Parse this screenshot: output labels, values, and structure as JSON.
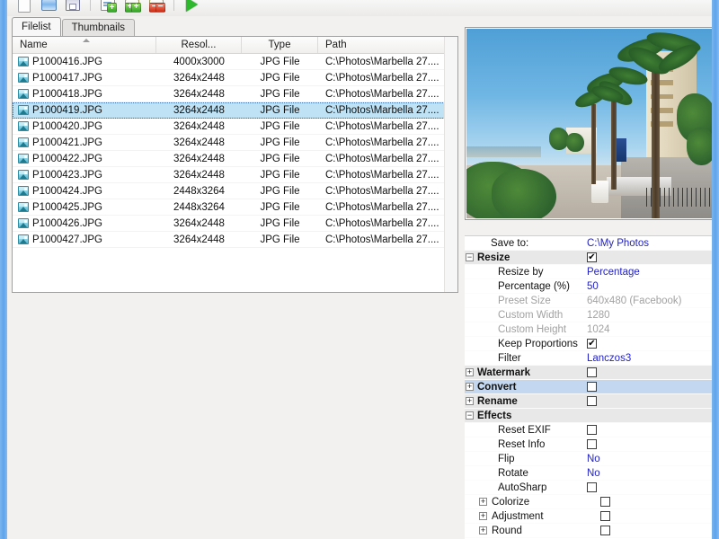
{
  "window": {
    "accent_color": "#6aa9e9"
  },
  "toolbar": {
    "buttons": [
      {
        "name": "new-document",
        "label": "New"
      },
      {
        "name": "open-folder",
        "label": "Open"
      },
      {
        "name": "save",
        "label": "Save"
      },
      {
        "name": "add-files",
        "label": "Add files"
      },
      {
        "name": "add-folder",
        "label": "Add folder"
      },
      {
        "name": "remove-files",
        "label": "Remove files"
      },
      {
        "name": "run",
        "label": "Start"
      }
    ]
  },
  "tabs": [
    {
      "label": "Filelist",
      "active": true
    },
    {
      "label": "Thumbnails",
      "active": false
    }
  ],
  "filelist": {
    "columns": [
      "Name",
      "Resol...",
      "Type",
      "Path"
    ],
    "sort_column": "Name",
    "sort_direction": "asc",
    "rows": [
      {
        "name": "P1000416.JPG",
        "resolution": "4000x3000",
        "type": "JPG File",
        "path": "C:\\Photos\\Marbella 27....",
        "selected": false
      },
      {
        "name": "P1000417.JPG",
        "resolution": "3264x2448",
        "type": "JPG File",
        "path": "C:\\Photos\\Marbella 27....",
        "selected": false
      },
      {
        "name": "P1000418.JPG",
        "resolution": "3264x2448",
        "type": "JPG File",
        "path": "C:\\Photos\\Marbella 27....",
        "selected": false
      },
      {
        "name": "P1000419.JPG",
        "resolution": "3264x2448",
        "type": "JPG File",
        "path": "C:\\Photos\\Marbella 27....",
        "selected": true
      },
      {
        "name": "P1000420.JPG",
        "resolution": "3264x2448",
        "type": "JPG File",
        "path": "C:\\Photos\\Marbella 27....",
        "selected": false
      },
      {
        "name": "P1000421.JPG",
        "resolution": "3264x2448",
        "type": "JPG File",
        "path": "C:\\Photos\\Marbella 27....",
        "selected": false
      },
      {
        "name": "P1000422.JPG",
        "resolution": "3264x2448",
        "type": "JPG File",
        "path": "C:\\Photos\\Marbella 27....",
        "selected": false
      },
      {
        "name": "P1000423.JPG",
        "resolution": "3264x2448",
        "type": "JPG File",
        "path": "C:\\Photos\\Marbella 27....",
        "selected": false
      },
      {
        "name": "P1000424.JPG",
        "resolution": "2448x3264",
        "type": "JPG File",
        "path": "C:\\Photos\\Marbella 27....",
        "selected": false
      },
      {
        "name": "P1000425.JPG",
        "resolution": "2448x3264",
        "type": "JPG File",
        "path": "C:\\Photos\\Marbella 27....",
        "selected": false
      },
      {
        "name": "P1000426.JPG",
        "resolution": "3264x2448",
        "type": "JPG File",
        "path": "C:\\Photos\\Marbella 27....",
        "selected": false
      },
      {
        "name": "P1000427.JPG",
        "resolution": "3264x2448",
        "type": "JPG File",
        "path": "C:\\Photos\\Marbella 27....",
        "selected": false
      }
    ]
  },
  "preview": {
    "name": "image-preview"
  },
  "properties": {
    "rows": [
      {
        "label": "Save to:",
        "value": "C:\\My Photos",
        "kind": "value",
        "style": "saveto"
      },
      {
        "label": "Resize",
        "kind": "check",
        "checked": true,
        "style": "group",
        "expander": "minus"
      },
      {
        "label": "Resize by",
        "value": "Percentage",
        "kind": "value",
        "style": "child"
      },
      {
        "label": "Percentage (%)",
        "value": "50",
        "kind": "value",
        "style": "child"
      },
      {
        "label": "Preset Size",
        "value": "640x480 (Facebook)",
        "kind": "value",
        "style": "child-dim"
      },
      {
        "label": "Custom Width",
        "value": "1280",
        "kind": "value",
        "style": "child-dim"
      },
      {
        "label": "Custom Height",
        "value": "1024",
        "kind": "value",
        "style": "child-dim"
      },
      {
        "label": "Keep Proportions",
        "kind": "check",
        "checked": true,
        "style": "child"
      },
      {
        "label": "Filter",
        "value": "Lanczos3",
        "kind": "value",
        "style": "child"
      },
      {
        "label": "Watermark",
        "kind": "check",
        "checked": false,
        "style": "group",
        "expander": "plus"
      },
      {
        "label": "Convert",
        "kind": "check",
        "checked": false,
        "style": "group-selected",
        "expander": "plus"
      },
      {
        "label": "Rename",
        "kind": "check",
        "checked": false,
        "style": "group",
        "expander": "plus"
      },
      {
        "label": "Effects",
        "kind": "none",
        "style": "group",
        "expander": "minus"
      },
      {
        "label": "Reset EXIF",
        "kind": "check",
        "checked": false,
        "style": "child"
      },
      {
        "label": "Reset Info",
        "kind": "check",
        "checked": false,
        "style": "child"
      },
      {
        "label": "Flip",
        "value": "No",
        "kind": "value",
        "style": "child"
      },
      {
        "label": "Rotate",
        "value": "No",
        "kind": "value",
        "style": "child"
      },
      {
        "label": "AutoSharp",
        "kind": "check",
        "checked": false,
        "style": "child"
      },
      {
        "label": "Colorize",
        "kind": "check",
        "checked": false,
        "style": "child-exp",
        "expander": "plus"
      },
      {
        "label": "Adjustment",
        "kind": "check",
        "checked": false,
        "style": "child-exp",
        "expander": "plus"
      },
      {
        "label": "Round",
        "kind": "check",
        "checked": false,
        "style": "child-exp",
        "expander": "plus"
      }
    ]
  }
}
